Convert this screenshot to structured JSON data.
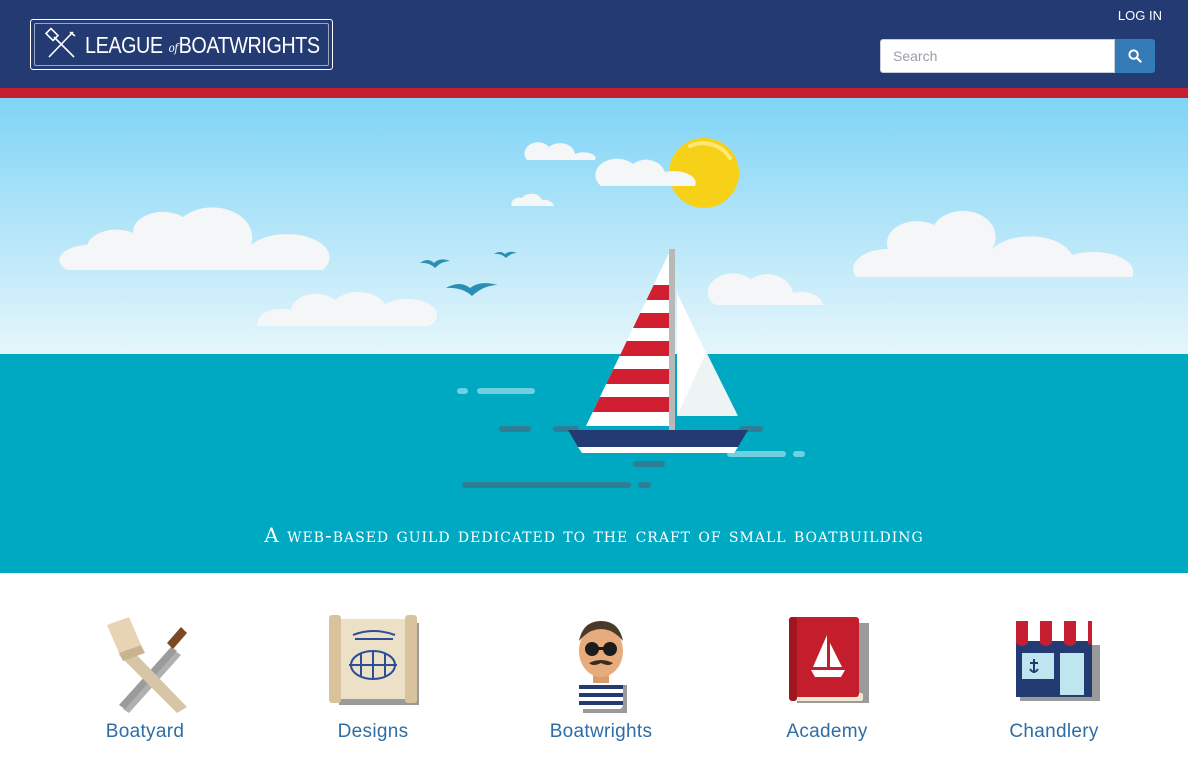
{
  "header": {
    "logo": {
      "brand": "LEAGUE",
      "connector": "of",
      "brand2": "BOATWRIGHTS"
    },
    "login_label": "LOG IN",
    "search": {
      "placeholder": "Search",
      "value": "",
      "icon": "search-icon"
    }
  },
  "hero": {
    "tagline": "A web-based guild dedicated to the craft of small boatbuilding"
  },
  "nav": {
    "items": [
      {
        "label": "Boatyard",
        "icon": "mallet-chisel-icon"
      },
      {
        "label": "Designs",
        "icon": "blueprint-scroll-icon"
      },
      {
        "label": "Boatwrights",
        "icon": "sailor-icon"
      },
      {
        "label": "Academy",
        "icon": "book-icon"
      },
      {
        "label": "Chandlery",
        "icon": "shop-icon"
      }
    ]
  },
  "colors": {
    "header_bg": "#243a73",
    "accent_red": "#c61f32",
    "sea": "#00a9c2",
    "link": "#2e6da4"
  }
}
